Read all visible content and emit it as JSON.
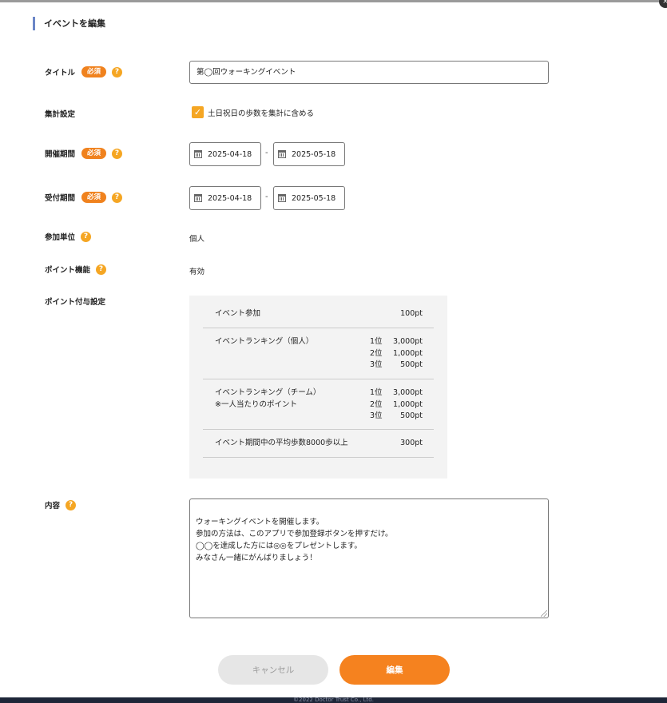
{
  "page": {
    "title": "イベントを編集",
    "close_symbol": "×"
  },
  "form": {
    "title_label": "タイトル",
    "required_badge": "必須",
    "help_symbol": "?",
    "title_value": "第◯回ウォーキングイベント",
    "aggregation_label": "集計設定",
    "aggregation_checkbox_label": "土日祝日の歩数を集計に含める",
    "aggregation_checked": true,
    "check_symbol": "✓",
    "event_period_label": "開催期間",
    "event_period_start": "2025-04-18",
    "event_period_end": "2025-05-18",
    "reception_period_label": "受付期間",
    "reception_period_start": "2025-04-18",
    "reception_period_end": "2025-05-18",
    "range_separator": "-",
    "participation_unit_label": "参加単位",
    "participation_unit_value": "個人",
    "point_feature_label": "ポイント機能",
    "point_feature_value": "有効",
    "point_settings_label": "ポイント付与設定",
    "content_label": "内容",
    "content_value": "ウォーキングイベントを開催します。\n参加の方法は、このアプリで参加登録ボタンを押すだけ。\n◯◯を達成した方には◎◎をプレゼントします。\nみなさん一緒にがんばりましょう！"
  },
  "points": {
    "event_participation": {
      "name": "イベント参加",
      "value": "100pt"
    },
    "individual_ranking": {
      "name": "イベントランキング（個人）",
      "ranks": [
        {
          "rank": "1位",
          "points": "3,000pt"
        },
        {
          "rank": "2位",
          "points": "1,000pt"
        },
        {
          "rank": "3位",
          "points": "500pt"
        }
      ]
    },
    "team_ranking": {
      "name": "イベントランキング（チーム）",
      "note": "※一人当たりのポイント",
      "ranks": [
        {
          "rank": "1位",
          "points": "3,000pt"
        },
        {
          "rank": "2位",
          "points": "1,000pt"
        },
        {
          "rank": "3位",
          "points": "500pt"
        }
      ]
    },
    "average_steps": {
      "name": "イベント期間中の平均歩数8000歩以上",
      "value": "300pt"
    }
  },
  "buttons": {
    "cancel": "キャンセル",
    "edit": "編集"
  },
  "footer": {
    "copyright": "©2022 Doctor Trust Co., Ltd."
  },
  "colors": {
    "accent": "#f5821f",
    "help": "#f5a623",
    "title_bar": "#6b86c7",
    "footer_bg": "#1e2638"
  }
}
